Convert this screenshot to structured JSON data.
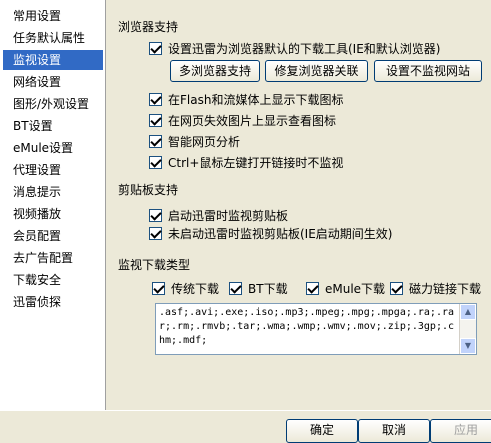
{
  "sidebar": {
    "items": [
      {
        "label": "常用设置"
      },
      {
        "label": "任务默认属性"
      },
      {
        "label": "监视设置"
      },
      {
        "label": "网络设置"
      },
      {
        "label": "图形/外观设置"
      },
      {
        "label": "BT设置"
      },
      {
        "label": "eMule设置"
      },
      {
        "label": "代理设置"
      },
      {
        "label": "消息提示"
      },
      {
        "label": "视频播放"
      },
      {
        "label": "会员配置"
      },
      {
        "label": "去广告配置"
      },
      {
        "label": "下载安全"
      },
      {
        "label": "迅雷侦探"
      }
    ],
    "selected": "监视设置"
  },
  "browser": {
    "title": "浏览器支持",
    "default_tool": {
      "label": "设置迅雷为浏览器默认的下载工具(IE和默认浏览器)",
      "checked": true
    },
    "buttons": {
      "multi": "多浏览器支持",
      "repair": "修复浏览器关联",
      "nomonitor": "设置不监视网站"
    },
    "options": [
      {
        "label": "在Flash和流媒体上显示下载图标",
        "checked": true
      },
      {
        "label": "在网页失效图片上显示查看图标",
        "checked": true
      },
      {
        "label": "智能网页分析",
        "checked": true
      },
      {
        "label": "Ctrl+鼠标左键打开链接时不监视",
        "checked": true
      }
    ]
  },
  "clipboard": {
    "title": "剪贴板支持",
    "options": [
      {
        "label": "启动迅雷时监视剪贴板",
        "checked": true
      },
      {
        "label": "未启动迅雷时监视剪贴板(IE启动期间生效)",
        "checked": true
      }
    ]
  },
  "download_types": {
    "title": "监视下载类型",
    "types": [
      {
        "label": "传统下载",
        "checked": true
      },
      {
        "label": "BT下载",
        "checked": true
      },
      {
        "label": "eMule下载",
        "checked": true
      },
      {
        "label": "磁力链接下载",
        "checked": true
      }
    ],
    "extensions": ".asf;.avi;.exe;.iso;.mp3;.mpeg;.mpg;.mpga;.ra;.rar;.rm;.rmvb;.tar;.wma;.wmp;.wmv;.mov;.zip;.3gp;.chm;.mdf;"
  },
  "footer": {
    "ok": "确定",
    "cancel": "取消",
    "apply": "应用"
  }
}
